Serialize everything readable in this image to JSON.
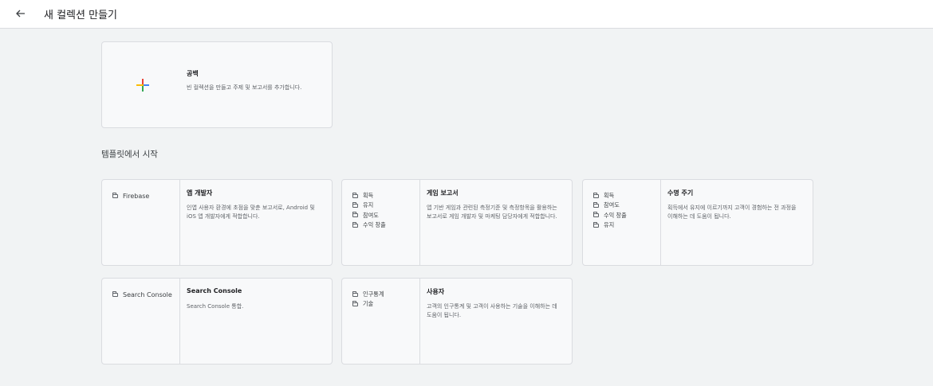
{
  "header": {
    "back_icon": "arrow-back-icon",
    "title": "새 컬렉션 만들기"
  },
  "blank": {
    "title": "공백",
    "description": "빈 컬렉션을 만들고 주제 및 보고서를 추가합니다."
  },
  "section_title": "템플릿에서 시작",
  "templates": [
    {
      "tags": [
        "Firebase"
      ],
      "title": "앱 개발자",
      "description": "인앱 사용자 환경에 초점을 맞춘 보고서로, Android 및 iOS 앱 개발자에게 적합합니다."
    },
    {
      "tags": [
        "획득",
        "유지",
        "참여도",
        "수익 창출"
      ],
      "title": "게임 보고서",
      "description": "앱 기반 게임과 관련된 측정기준 및 측정항목을 활용하는 보고서로 게임 개발자 및 마케팅 담당자에게 적합합니다."
    },
    {
      "tags": [
        "획득",
        "참여도",
        "수익 창출",
        "유지"
      ],
      "title": "수명 주기",
      "description": "획득에서 유지에 이르기까지 고객이 경험하는 전 과정을 이해하는 데 도움이 됩니다."
    },
    {
      "tags": [
        "Search Console"
      ],
      "title": "Search Console",
      "description": "Search Console 통합."
    },
    {
      "tags": [
        "인구통계",
        "기술"
      ],
      "title": "사용자",
      "description": "고객의 인구통계 및 고객이 사용하는 기술을 이해하는 데 도움이 됩니다."
    }
  ]
}
